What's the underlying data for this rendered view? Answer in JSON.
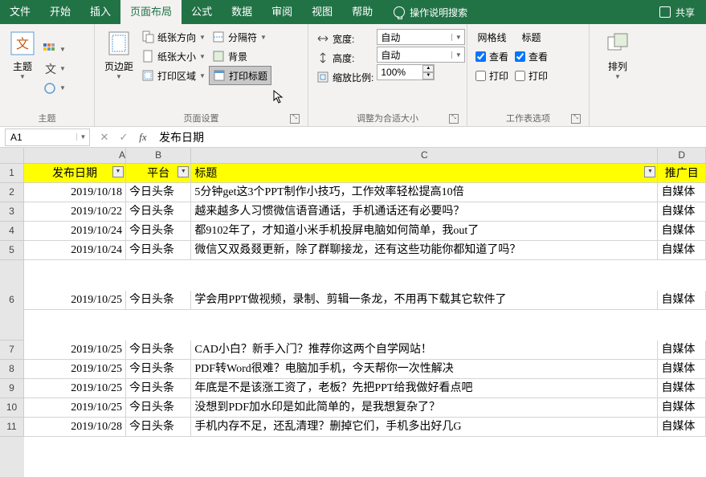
{
  "tabs": {
    "file": "文件",
    "home": "开始",
    "insert": "插入",
    "layout": "页面布局",
    "formula": "公式",
    "data": "数据",
    "review": "审阅",
    "view": "视图",
    "help": "帮助"
  },
  "tellme": "操作说明搜索",
  "share": "共享",
  "ribbon": {
    "themes": {
      "label": "主题",
      "btn": "主题"
    },
    "pagesetup": {
      "label": "页面设置",
      "margins": "页边距",
      "orientation": "纸张方向",
      "size": "纸张大小",
      "printarea": "打印区域",
      "breaks": "分隔符",
      "background": "背景",
      "titles": "打印标题"
    },
    "scale": {
      "label": "调整为合适大小",
      "width": "宽度:",
      "height": "高度:",
      "ratio": "缩放比例:",
      "auto": "自动",
      "pct": "100%"
    },
    "sheetopts": {
      "label": "工作表选项",
      "grid": "网格线",
      "head": "标题",
      "view": "查看",
      "print": "打印"
    },
    "arrange": {
      "label": "",
      "btn": "排列"
    }
  },
  "namebox": "A1",
  "formula": "发布日期",
  "colHeads": {
    "A": "A",
    "B": "B",
    "C": "C",
    "D": "D"
  },
  "headers": {
    "date": "发布日期",
    "platform": "平台",
    "title": "标题",
    "promo": "推广目"
  },
  "rows": [
    {
      "n": "2",
      "d": "2019/10/18",
      "p": "今日头条",
      "t": "5分钟get这3个PPT制作小技巧，工作效率轻松提高10倍",
      "r": "自媒体"
    },
    {
      "n": "3",
      "d": "2019/10/22",
      "p": "今日头条",
      "t": "越来越多人习惯微信语音通话，手机通话还有必要吗？",
      "r": "自媒体"
    },
    {
      "n": "4",
      "d": "2019/10/24",
      "p": "今日头条",
      "t": "都9102年了，才知道小米手机投屏电脑如何简单，我out了",
      "r": "自媒体"
    },
    {
      "n": "5",
      "d": "2019/10/24",
      "p": "今日头条",
      "t": "微信又双叒叕更新，除了群聊接龙，还有这些功能你都知道了吗？",
      "r": "自媒体"
    },
    {
      "n": "6",
      "d": "2019/10/25",
      "p": "今日头条",
      "t": "学会用PPT做视频，录制、剪辑一条龙，不用再下载其它软件了",
      "r": "自媒体",
      "tall": true
    },
    {
      "n": "7",
      "d": "2019/10/25",
      "p": "今日头条",
      "t": "CAD小白？新手入门？推荐你这两个自学网站！",
      "r": "自媒体"
    },
    {
      "n": "8",
      "d": "2019/10/25",
      "p": "今日头条",
      "t": "PDF转Word很难？电脑加手机，今天帮你一次性解决",
      "r": "自媒体"
    },
    {
      "n": "9",
      "d": "2019/10/25",
      "p": "今日头条",
      "t": "年底是不是该涨工资了，老板？先把PPT给我做好看点吧",
      "r": "自媒体"
    },
    {
      "n": "10",
      "d": "2019/10/25",
      "p": "今日头条",
      "t": "没想到PDF加水印是如此简单的，是我想复杂了？",
      "r": "自媒体"
    },
    {
      "n": "11",
      "d": "2019/10/28",
      "p": "今日头条",
      "t": "手机内存不足，还乱清理？删掉它们，手机多出好几G",
      "r": "自媒体"
    }
  ]
}
